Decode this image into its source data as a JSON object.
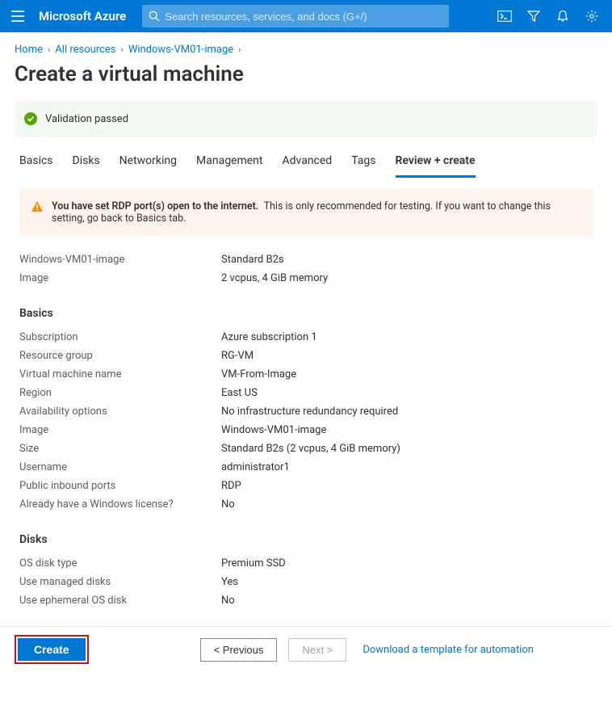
{
  "header": {
    "brand": "Microsoft Azure",
    "search_placeholder": "Search resources, services, and docs (G+/)"
  },
  "breadcrumbs": [
    "Home",
    "All resources",
    "Windows-VM01-image"
  ],
  "page_title": "Create a virtual machine",
  "validation_message": "Validation passed",
  "tabs": [
    "Basics",
    "Disks",
    "Networking",
    "Management",
    "Advanced",
    "Tags",
    "Review + create"
  ],
  "active_tab_index": 6,
  "warning": {
    "bold": "You have set RDP port(s) open to the internet.",
    "rest": "This is only recommended for testing.  If you want to change this setting, go back to Basics tab."
  },
  "summary_top": [
    {
      "k": "Windows-VM01-image",
      "v": "Standard B2s"
    },
    {
      "k": "Image",
      "v": "2 vcpus, 4 GiB memory"
    }
  ],
  "sections": {
    "basics": {
      "title": "Basics",
      "rows": [
        {
          "k": "Subscription",
          "v": "Azure subscription 1"
        },
        {
          "k": "Resource group",
          "v": "RG-VM"
        },
        {
          "k": "Virtual machine name",
          "v": "VM-From-Image"
        },
        {
          "k": "Region",
          "v": "East US"
        },
        {
          "k": "Availability options",
          "v": "No infrastructure redundancy required"
        },
        {
          "k": "Image",
          "v": "Windows-VM01-image"
        },
        {
          "k": "Size",
          "v": "Standard B2s (2 vcpus, 4 GiB memory)"
        },
        {
          "k": "Username",
          "v": "administrator1"
        },
        {
          "k": "Public inbound ports",
          "v": "RDP"
        },
        {
          "k": "Already have a Windows license?",
          "v": "No"
        }
      ]
    },
    "disks": {
      "title": "Disks",
      "rows": [
        {
          "k": "OS disk type",
          "v": "Premium SSD"
        },
        {
          "k": "Use managed disks",
          "v": "Yes"
        },
        {
          "k": "Use ephemeral OS disk",
          "v": "No"
        }
      ]
    }
  },
  "footer": {
    "create": "Create",
    "prev": "< Previous",
    "next": "Next >",
    "download": "Download a template for automation"
  }
}
